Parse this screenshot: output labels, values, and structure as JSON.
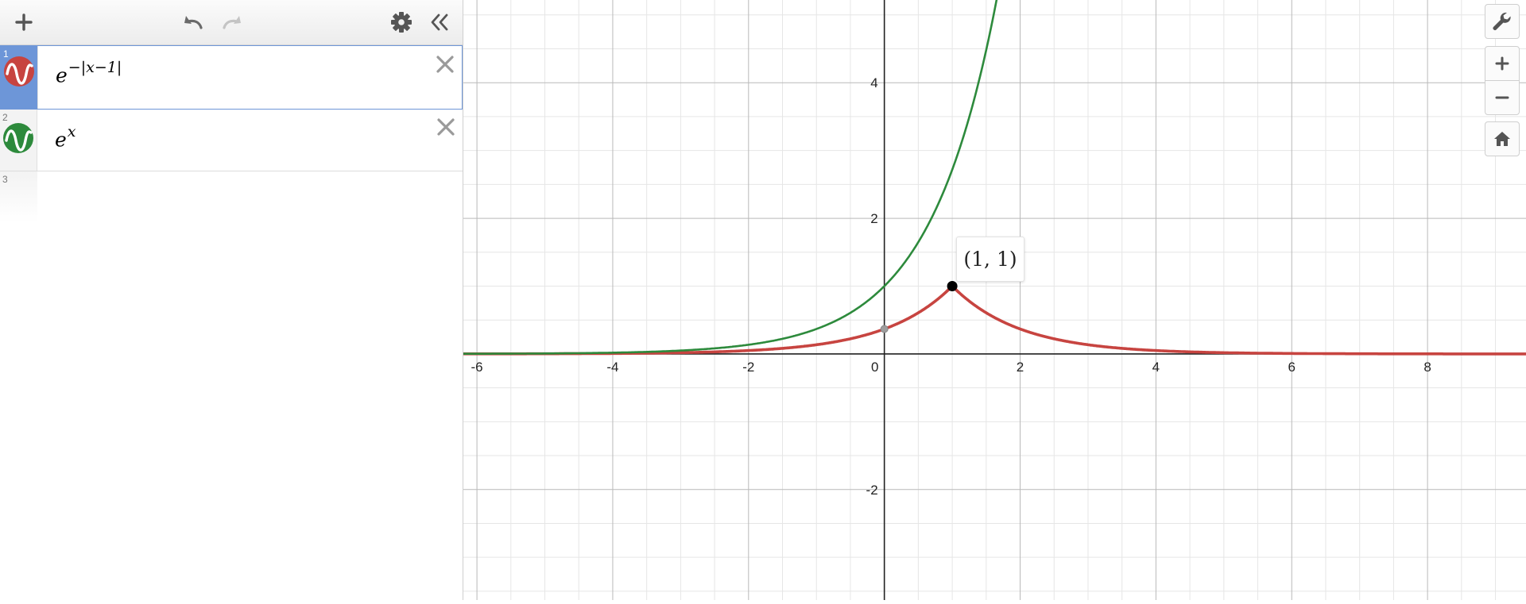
{
  "toolbar": {
    "add_icon": "plus-icon",
    "undo_icon": "undo-icon",
    "redo_icon": "redo-icon",
    "settings_icon": "gear-icon",
    "collapse_icon": "double-chevron-left-icon"
  },
  "expressions": [
    {
      "index": "1",
      "base": "e",
      "exponent": "−|x−1|",
      "color": "#c74440",
      "active": true
    },
    {
      "index": "2",
      "base": "e",
      "exponent": "x",
      "color": "#2d8a3c",
      "active": false
    },
    {
      "index": "3",
      "base": "",
      "exponent": "",
      "color": "",
      "active": false
    }
  ],
  "graph_controls": {
    "wrench_icon": "wrench-icon",
    "zoom_in_icon": "plus-icon",
    "zoom_out_icon": "minus-icon",
    "home_icon": "home-icon"
  },
  "point_label": "(1, 1)",
  "chart_data": {
    "type": "line",
    "xlim": [
      -6.2,
      9.45
    ],
    "ylim": [
      -3.63,
      5.22
    ],
    "grid": true,
    "x_ticks": [
      "-6",
      "-4",
      "-2",
      "0",
      "2",
      "4",
      "6",
      "8"
    ],
    "y_ticks": [
      "4",
      "2",
      "-2"
    ],
    "series": [
      {
        "formula": "e^{-|x-1|}",
        "color": "#c74440"
      },
      {
        "formula": "e^{x}",
        "color": "#2d8a3c"
      }
    ],
    "points": [
      {
        "x": 1,
        "y": 1,
        "label": "(1, 1)",
        "color": "#000000"
      },
      {
        "x": 0,
        "y": 0.368,
        "color": "#9e9e9e"
      }
    ]
  }
}
